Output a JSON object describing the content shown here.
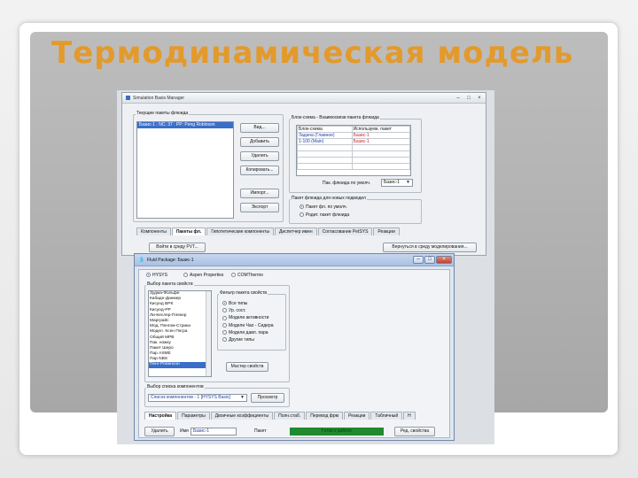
{
  "slide": {
    "title": "Термодинамическая модель"
  },
  "sbm": {
    "title": "Simulation Basis Manager",
    "controls": {
      "min": "–",
      "max": "□",
      "close": "×"
    },
    "current_packages_label": "Текущие пакеты флюида",
    "current_packages": [
      "Базис-1  : NC: 37 : PP: Peng Robinson"
    ],
    "buttons": {
      "view": "Вид...",
      "add": "Добавить",
      "delete": "Удалить",
      "copy": "Копировать...",
      "import": "Импорт...",
      "export": "Экспорт"
    },
    "flowsheet_group_label": "Блок-схема - Взаимосвязи пакета флюида",
    "grid_headers": [
      "Блок-схема",
      "Используем. пакет"
    ],
    "grid_rows": [
      [
        "Задача (Главное)",
        "Базис-1"
      ],
      [
        "1-100 (Main)",
        "Базис-1"
      ]
    ],
    "default_pkg_label": "Пак. флюида по умолч.",
    "default_pkg_value": "Базис-1",
    "new_unit_group_label": "Пакет флюида для новых подмодел",
    "radio_use_default": "Пакет фл. по умолч.",
    "radio_use_parent": "Родит. пакет флюида",
    "tabs": [
      "Компоненты",
      "Пакеты фл.",
      "Гипотетические компоненты",
      "Диспетчер имен",
      "Согласование PetSYS",
      "Реакции"
    ],
    "active_tab": 1,
    "enter_env_button": "Войти в среду PVT...",
    "return_button": "Вернуться в среду моделирования..."
  },
  "fpkg": {
    "title": "Fluid Package: Базис-1",
    "controls": {
      "min": "–",
      "max": "□",
      "close": "×"
    },
    "source_options": [
      "HYSYS",
      "Aspen Properties",
      "COMThermo"
    ],
    "source_selected": 0,
    "props_group_label": "Выбор пакета свойств",
    "property_packages": [
      "Зуджа-Фольфе",
      "Кабаде-Данмер",
      "Кисунд ВРК",
      "Кисунд-РР",
      "Ли-Кеслер-Плекер",
      "Марграйс",
      "Мод. Пенгом-Стрика",
      "Модел. Ксен Пнгра",
      "Общий МРВ",
      "Пак. ножку",
      "Пакет Шеро",
      "Пар ASME",
      "Пар NBS",
      "Пенг-Робинсон"
    ],
    "property_selected": 13,
    "filter_group_label": "Фильтр пакета свойств",
    "filter_options": [
      "Все типы",
      "Ур. сост.",
      "Модели активности",
      "Модели Чао - Сидера",
      "Модели давл. пара",
      "Другие типы"
    ],
    "filter_selected": 0,
    "wizard_button": "Мастер свойств",
    "comp_group_label": "Выбор списка компонентов",
    "comp_list_value": "Список компонентов - 1 [HYSYS Basis]",
    "view_button": "Просмотр",
    "tabs": [
      "Настройка",
      "Параметры",
      "Двоичные коэффициенты",
      "Полн.стаб.",
      "Перевод фрм",
      "Реакции",
      "Табличный",
      "Н"
    ],
    "active_tab": 0,
    "delete_button": "Удалить",
    "name_label": "Имя",
    "name_value": "Базис-1",
    "status_label": "Пакет",
    "status_value": "Готов к работе",
    "status_color": "#1f8a2e",
    "edit_props_button": "Ред. свойства"
  }
}
